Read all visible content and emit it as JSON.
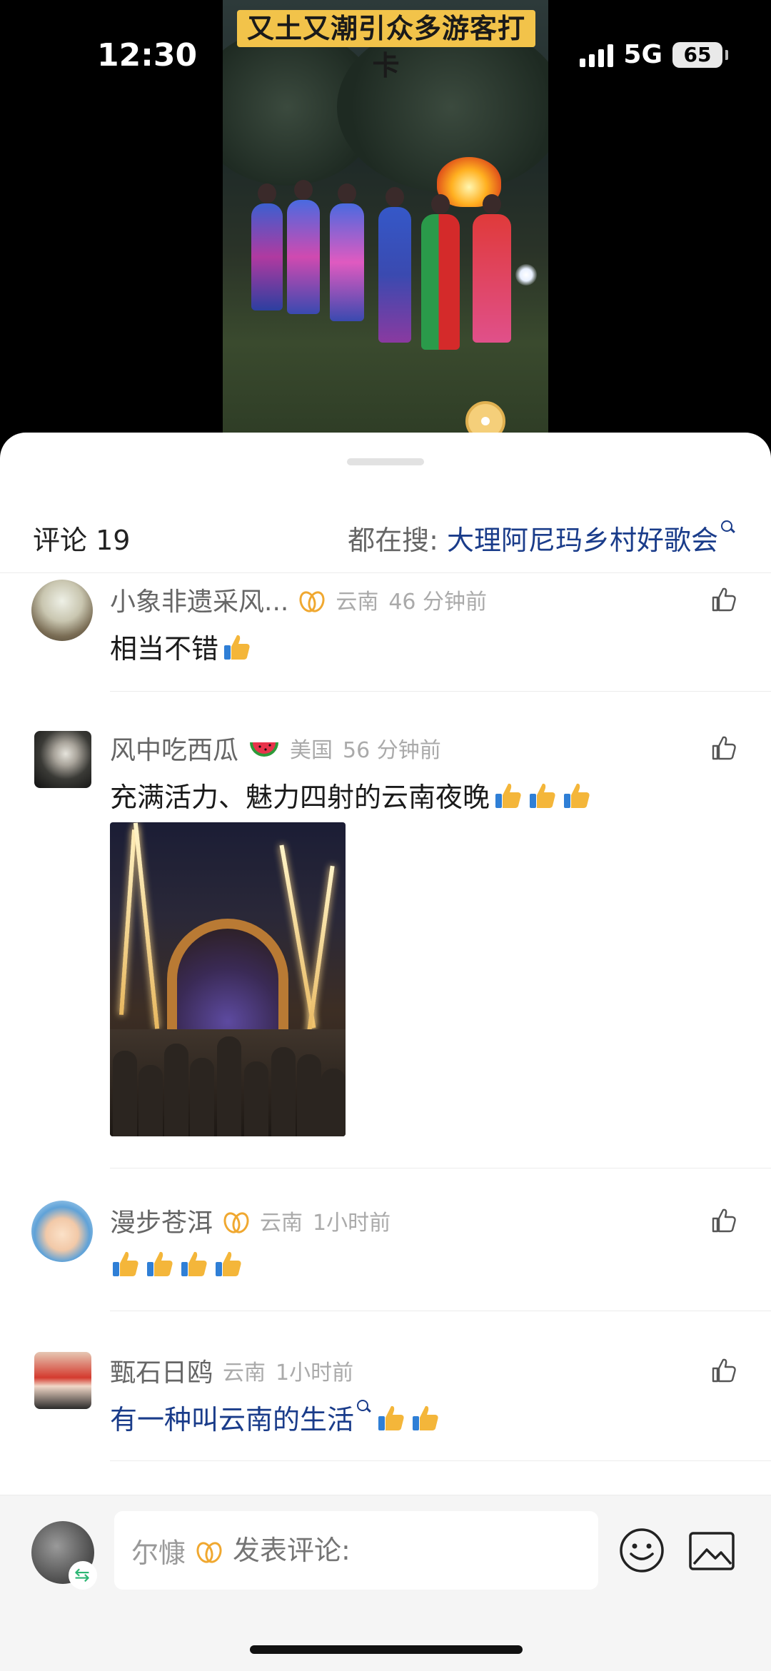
{
  "status_bar": {
    "time": "12:30",
    "network": "5G",
    "battery": "65"
  },
  "video": {
    "caption": "又土又潮引众多游客打卡"
  },
  "comments_header": {
    "title": "评论 19",
    "hot_search_label": "都在搜:",
    "hot_search_keyword": "大理阿尼玛乡村好歌会"
  },
  "comments": [
    {
      "name": "小象非遗采风...",
      "location": "云南",
      "time": "46 分钟前",
      "text": "相当不错",
      "vip": true,
      "thumbs": 1
    },
    {
      "name": "风中吃西瓜",
      "location": "美国",
      "time": "56 分钟前",
      "text": "充满活力、魅力四射的云南夜晚",
      "vip": false,
      "thumbs": 3,
      "has_image": true
    },
    {
      "name": "漫步苍洱",
      "location": "云南",
      "time": "1小时前",
      "text": "",
      "vip": true,
      "thumbs": 4
    },
    {
      "name": "甄石日鸥",
      "location": "云南",
      "time": "1小时前",
      "text": "有一种叫云南的生活",
      "vip": false,
      "thumbs": 2,
      "text_is_link": true
    }
  ],
  "input_bar": {
    "username": "尔慷",
    "placeholder": "发表评论:"
  },
  "colors": {
    "link": "#1a3c8a",
    "vip": "#f0a830",
    "thumb": "#f4b63a"
  },
  "icons": [
    "search-icon",
    "like-icon",
    "vip-badge-icon",
    "thumbs-up-emoji",
    "watermelon-emoji",
    "emoji-icon",
    "image-icon",
    "repost-badge-icon"
  ]
}
